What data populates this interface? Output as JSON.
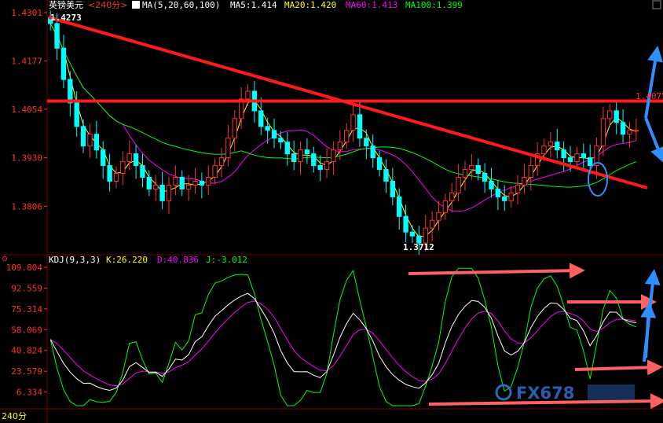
{
  "header": {
    "instrument": "英镑美元",
    "period_tag": "<240分>",
    "ma_label": "MA(5,20,60,100)",
    "ma5": "MA5:1.414",
    "ma20": "MA20:1.420",
    "ma60": "MA60:1.413",
    "ma100": "MA100:1.399"
  },
  "kdj_header": {
    "label": "KDJ(9,3,3)",
    "k": "K:26.220",
    "d": "D:40.836",
    "j": "J:-3.012"
  },
  "footer": {
    "period": "240分"
  },
  "watermark": "FX678",
  "colors": {
    "bg": "#000000",
    "up": "#ff3030",
    "down": "#00ffff",
    "ma5": "#ffffff",
    "ma20": "#ffff00",
    "ma60": "#ff00ff",
    "ma100": "#00ff00",
    "trendline": "#ff1a1a",
    "arrow_blue": "#2f8fff",
    "arrow_salmon": "#ff6060",
    "k_line": "#ffffff",
    "d_line": "#ff00ff",
    "j_line": "#00ff00",
    "axis_text": "#ff3030",
    "grid": "#5a0000"
  },
  "chart_data": [
    {
      "type": "candlestick",
      "title": "英镑美元 <240分>",
      "y_ticks": [
        1.4301,
        1.4177,
        1.4054,
        1.393,
        1.3806
      ],
      "ylim": [
        1.3682,
        1.4301
      ],
      "annotations": {
        "high": "1.4273",
        "low": "1.3712",
        "level_label": "1.4075",
        "level_value": 1.4075
      },
      "series": [
        {
          "name": "MA5",
          "value": 1.414
        },
        {
          "name": "MA20",
          "value": 1.42
        },
        {
          "name": "MA60",
          "value": 1.413
        },
        {
          "name": "MA100",
          "value": 1.399
        }
      ],
      "close": [
        1.4273,
        1.421,
        1.413,
        1.407,
        1.401,
        1.396,
        1.399,
        1.395,
        1.391,
        1.387,
        1.389,
        1.392,
        1.394,
        1.391,
        1.388,
        1.385,
        1.386,
        1.382,
        1.386,
        1.388,
        1.385,
        1.386,
        1.387,
        1.386,
        1.388,
        1.391,
        1.393,
        1.398,
        1.403,
        1.408,
        1.41,
        1.405,
        1.401,
        1.4,
        1.398,
        1.397,
        1.394,
        1.392,
        1.395,
        1.394,
        1.391,
        1.39,
        1.392,
        1.395,
        1.397,
        1.4,
        1.404,
        1.398,
        1.396,
        1.393,
        1.39,
        1.387,
        1.383,
        1.378,
        1.374,
        1.373,
        1.3712,
        1.375,
        1.377,
        1.379,
        1.382,
        1.384,
        1.388,
        1.39,
        1.391,
        1.389,
        1.387,
        1.385,
        1.383,
        1.382,
        1.384,
        1.386,
        1.388,
        1.391,
        1.394,
        1.396,
        1.397,
        1.395,
        1.393,
        1.392,
        1.394,
        1.393,
        1.391,
        1.396,
        1.403,
        1.405,
        1.402,
        1.399,
        1.4,
        1.4
      ]
    },
    {
      "type": "line",
      "title": "KDJ(9,3,3)",
      "y_ticks": [
        109.804,
        92.559,
        75.314,
        58.069,
        40.824,
        23.579,
        6.334
      ],
      "ylim": [
        -5,
        109.804
      ],
      "series": [
        {
          "name": "K",
          "value": 26.22
        },
        {
          "name": "D",
          "value": 40.836
        },
        {
          "name": "J",
          "value": -3.012
        }
      ]
    }
  ]
}
